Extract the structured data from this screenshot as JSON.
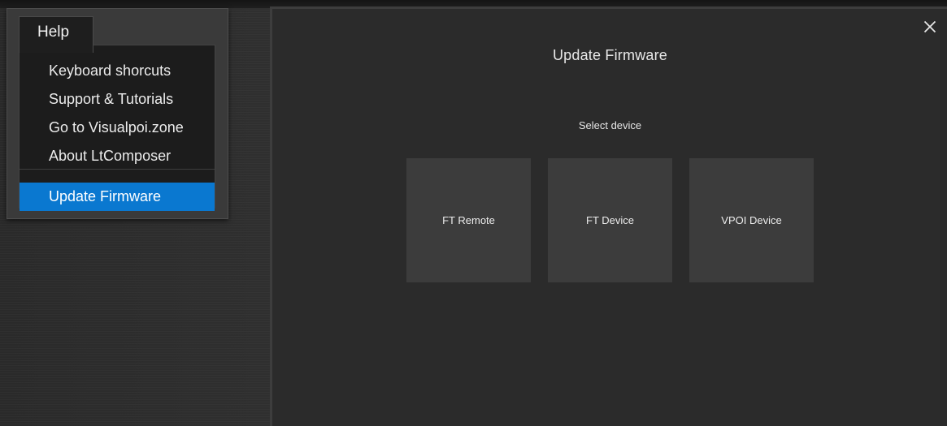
{
  "menu": {
    "title": "Help",
    "items": [
      {
        "label": "Keyboard shorcuts"
      },
      {
        "label": "Support & Tutorials"
      },
      {
        "label": "Go to Visualpoi.zone"
      },
      {
        "label": "About LtComposer"
      },
      {
        "label": "Update Firmware",
        "selected": true
      }
    ],
    "selected_color": "#0a78d0"
  },
  "dialog": {
    "title": "Update Firmware",
    "close_icon": "close-icon",
    "prompt": "Select device",
    "devices": [
      {
        "label": "FT Remote"
      },
      {
        "label": "FT Device"
      },
      {
        "label": "VPOI Device"
      }
    ]
  }
}
